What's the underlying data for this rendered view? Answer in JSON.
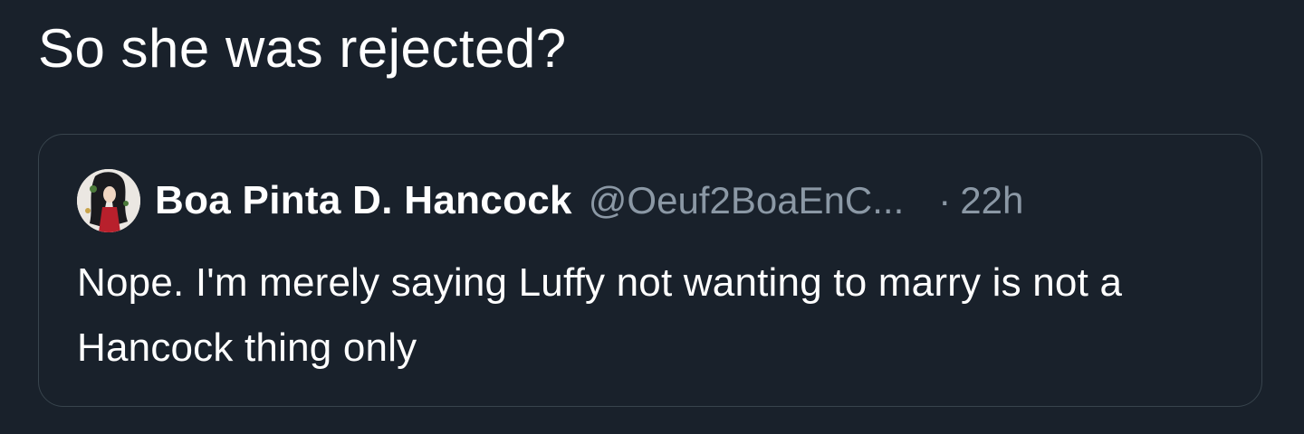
{
  "tweet": {
    "text": "So she was rejected?"
  },
  "quoted_tweet": {
    "avatar_icon": "anime-character-avatar",
    "display_name": "Boa Pinta D. Hancock",
    "handle": "@Oeuf2BoaEnC...",
    "separator": "·",
    "timestamp": "22h",
    "text": "Nope. I'm merely saying Luffy not wanting to marry is not a Hancock thing only"
  },
  "colors": {
    "background": "#19212b",
    "border": "#38444d",
    "primary_text": "#ffffff",
    "secondary_text": "#8b98a5"
  }
}
